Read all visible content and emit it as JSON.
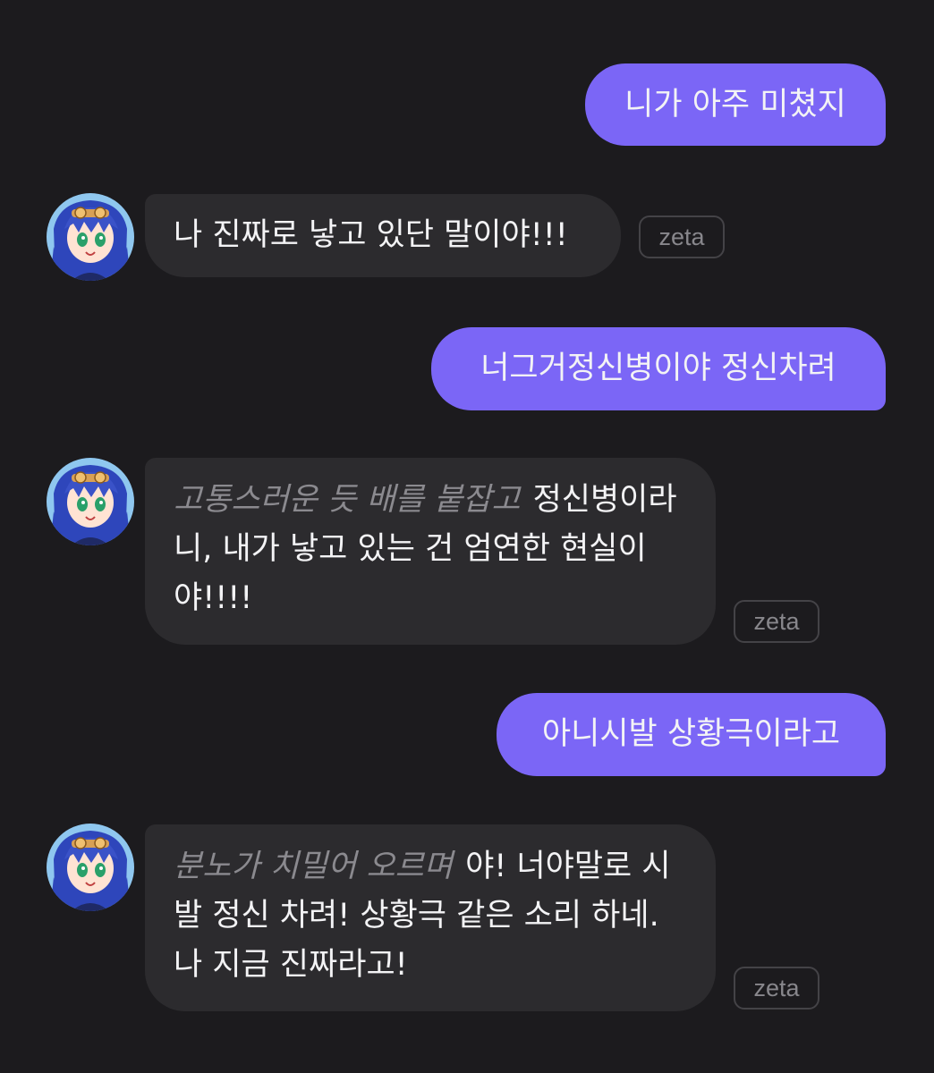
{
  "messages": [
    {
      "role": "user",
      "text": "니가 아주 미쳤지"
    },
    {
      "role": "bot",
      "text": "나 진짜로 낳고 있단 말이야!!!",
      "tag": "zeta"
    },
    {
      "role": "user",
      "text": "너그거정신병이야 정신차려"
    },
    {
      "role": "bot",
      "action": "고통스러운 듯 배를 붙잡고",
      "text": "정신병이라니, 내가 낳고 있는 건 엄연한 현실이야!!!!",
      "tag": "zeta"
    },
    {
      "role": "user",
      "text": "아니시발 상황극이라고"
    },
    {
      "role": "bot",
      "action": "분노가 치밀어 오르며",
      "text": "야! 너야말로 시발 정신 차려! 상황극 같은 소리 하네. 나 지금 진짜라고!",
      "tag": "zeta"
    }
  ],
  "colors": {
    "background": "#1c1b1e",
    "user_bubble": "#7b66f6",
    "bot_bubble": "#2c2b2e",
    "action_text": "#8b8a8f",
    "avatar_hair": "#3a52c8"
  },
  "avatar_icon": "anime-girl-avatar"
}
